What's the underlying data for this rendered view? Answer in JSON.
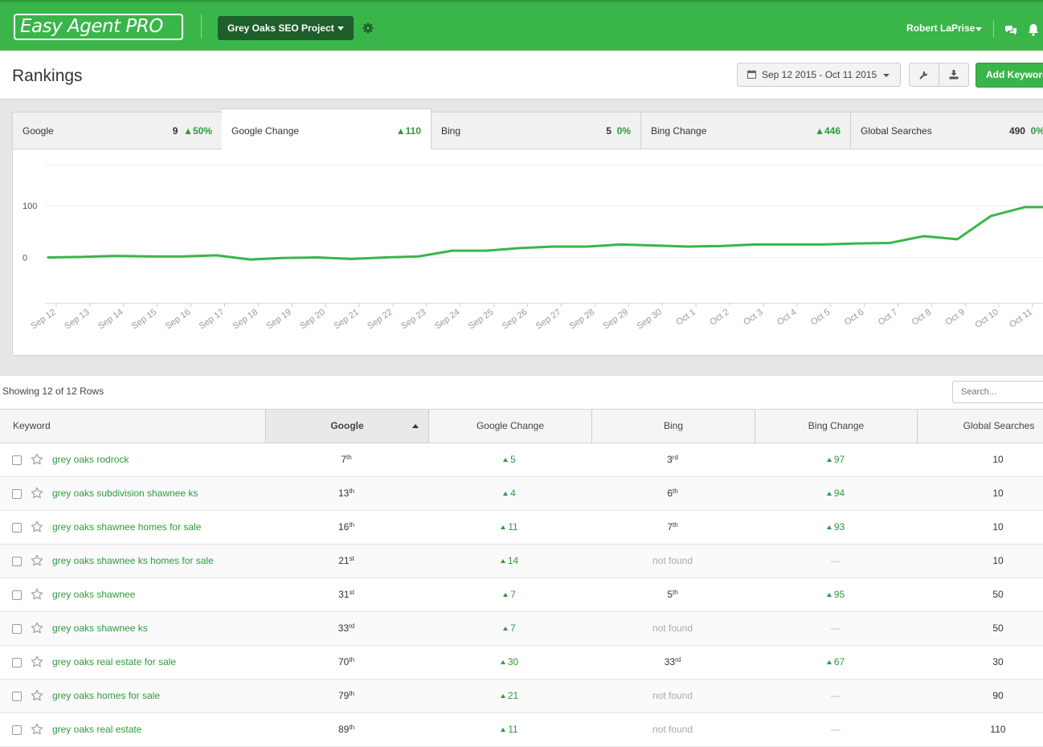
{
  "header": {
    "logo": "Easy Agent PRO",
    "project": "Grey Oaks SEO Project",
    "user": "Robert LaPrise",
    "icons": [
      "gear-icon",
      "chat-icon",
      "bell-icon"
    ],
    "brand_color": "#3ab54a"
  },
  "toolbar": {
    "title": "Rankings",
    "date_range": "Sep 12 2015 - Oct 11 2015",
    "add_label": "Add Keyword"
  },
  "tabs": [
    {
      "label": "Google",
      "value": "9",
      "change": "50%",
      "direction": "up"
    },
    {
      "label": "Google Change",
      "value": "110",
      "direction": "up"
    },
    {
      "label": "Bing",
      "value": "5",
      "change": "0%"
    },
    {
      "label": "Bing Change",
      "value": "446",
      "direction": "up"
    },
    {
      "label": "Global Searches",
      "value": "490",
      "change": "0%"
    }
  ],
  "chart_data": {
    "type": "line",
    "x": [
      "Sep 12",
      "Sep 13",
      "Sep 14",
      "Sep 15",
      "Sep 16",
      "Sep 17",
      "Sep 18",
      "Sep 19",
      "Sep 20",
      "Sep 21",
      "Sep 22",
      "Sep 23",
      "Sep 24",
      "Sep 25",
      "Sep 26",
      "Sep 27",
      "Sep 28",
      "Sep 29",
      "Sep 30",
      "Oct 1",
      "Oct 2",
      "Oct 3",
      "Oct 4",
      "Oct 5",
      "Oct 6",
      "Oct 7",
      "Oct 8",
      "Oct 9",
      "Oct 10",
      "Oct 11"
    ],
    "series": [
      {
        "values": [
          0,
          1,
          3,
          2,
          2,
          4,
          -4,
          -1,
          0,
          -3,
          0,
          2,
          13,
          13,
          18,
          21,
          21,
          25,
          23,
          21,
          22,
          25,
          25,
          25,
          27,
          28,
          41,
          35,
          80,
          97
        ]
      }
    ],
    "yticks": [
      0,
      100
    ],
    "ylim": [
      -90,
      180
    ],
    "grid": true,
    "color": "#3ab54a"
  },
  "table": {
    "showing": "Showing 12 of 12 Rows",
    "search_placeholder": "Search...",
    "columns": [
      "Keyword",
      "Google",
      "Google Change",
      "Bing",
      "Bing Change",
      "Global Searches"
    ],
    "rows": [
      {
        "keyword": "grey oaks rodrock",
        "google": "7",
        "google_sfx": "th",
        "gchange": "5",
        "bing": "3",
        "bing_sfx": "rd",
        "bchange": "97",
        "searches": "10"
      },
      {
        "keyword": "grey oaks subdivision shawnee ks",
        "google": "13",
        "google_sfx": "th",
        "gchange": "4",
        "bing": "6",
        "bing_sfx": "th",
        "bchange": "94",
        "searches": "10"
      },
      {
        "keyword": "grey oaks shawnee homes for sale",
        "google": "16",
        "google_sfx": "th",
        "gchange": "11",
        "bing": "7",
        "bing_sfx": "th",
        "bchange": "93",
        "searches": "10"
      },
      {
        "keyword": "grey oaks shawnee ks homes for sale",
        "google": "21",
        "google_sfx": "st",
        "gchange": "14",
        "bing": "not found",
        "bing_sfx": "",
        "bchange": "—",
        "searches": "10"
      },
      {
        "keyword": "grey oaks shawnee",
        "google": "31",
        "google_sfx": "st",
        "gchange": "7",
        "bing": "5",
        "bing_sfx": "th",
        "bchange": "95",
        "searches": "50"
      },
      {
        "keyword": "grey oaks shawnee ks",
        "google": "33",
        "google_sfx": "rd",
        "gchange": "7",
        "bing": "not found",
        "bing_sfx": "",
        "bchange": "—",
        "searches": "50"
      },
      {
        "keyword": "grey oaks real estate for sale",
        "google": "70",
        "google_sfx": "th",
        "gchange": "30",
        "bing": "33",
        "bing_sfx": "rd",
        "bchange": "67",
        "searches": "30"
      },
      {
        "keyword": "grey oaks homes for sale",
        "google": "79",
        "google_sfx": "th",
        "gchange": "21",
        "bing": "not found",
        "bing_sfx": "",
        "bchange": "—",
        "searches": "90"
      },
      {
        "keyword": "grey oaks real estate",
        "google": "89",
        "google_sfx": "th",
        "gchange": "11",
        "bing": "not found",
        "bing_sfx": "",
        "bchange": "—",
        "searches": "110"
      }
    ]
  }
}
